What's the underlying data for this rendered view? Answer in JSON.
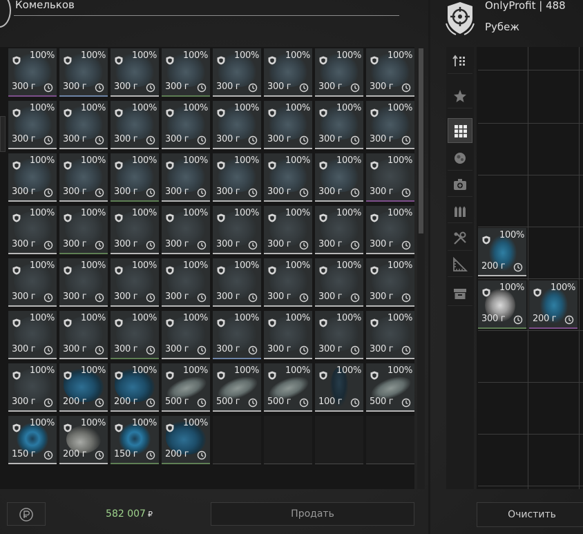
{
  "left_panel": {
    "title": "Комельков",
    "items": [
      {
        "row": 0,
        "col": 0,
        "icon": "needle-cluster-icon",
        "rarity": "violet",
        "durability": "100%",
        "price": "300 г"
      },
      {
        "row": 0,
        "col": 1,
        "icon": "needle-cluster-icon",
        "rarity": "blue",
        "durability": "100%",
        "price": "300 г"
      },
      {
        "row": 0,
        "col": 2,
        "icon": "needle-cluster-icon",
        "rarity": "white",
        "durability": "100%",
        "price": "300 г"
      },
      {
        "row": 0,
        "col": 3,
        "icon": "needle-cluster-icon",
        "rarity": "green",
        "durability": "100%",
        "price": "300 г"
      },
      {
        "row": 0,
        "col": 4,
        "icon": "needle-cluster-icon",
        "rarity": "white",
        "durability": "100%",
        "price": "300 г"
      },
      {
        "row": 0,
        "col": 5,
        "icon": "needle-cluster-icon",
        "rarity": "white",
        "durability": "100%",
        "price": "300 г"
      },
      {
        "row": 0,
        "col": 6,
        "icon": "needle-cluster-icon",
        "rarity": "white",
        "durability": "100%",
        "price": "300 г"
      },
      {
        "row": 0,
        "col": 7,
        "icon": "needle-cluster-icon",
        "rarity": "white",
        "durability": "100%",
        "price": "300 г"
      },
      {
        "row": 1,
        "col": 0,
        "icon": "needle-cluster-icon",
        "rarity": "white",
        "durability": "100%",
        "price": "300 г"
      },
      {
        "row": 1,
        "col": 1,
        "icon": "needle-cluster-icon",
        "rarity": "white",
        "durability": "100%",
        "price": "300 г"
      },
      {
        "row": 1,
        "col": 2,
        "icon": "needle-cluster-icon",
        "rarity": "white",
        "durability": "100%",
        "price": "300 г"
      },
      {
        "row": 1,
        "col": 3,
        "icon": "needle-cluster-icon",
        "rarity": "white",
        "durability": "100%",
        "price": "300 г"
      },
      {
        "row": 1,
        "col": 4,
        "icon": "needle-cluster-icon",
        "rarity": "white",
        "durability": "100%",
        "price": "300 г"
      },
      {
        "row": 1,
        "col": 5,
        "icon": "needle-cluster-icon",
        "rarity": "white",
        "durability": "100%",
        "price": "300 г"
      },
      {
        "row": 1,
        "col": 6,
        "icon": "needle-cluster-icon",
        "rarity": "white",
        "durability": "100%",
        "price": "300 г"
      },
      {
        "row": 1,
        "col": 7,
        "icon": "needle-cluster-icon",
        "rarity": "white",
        "durability": "100%",
        "price": "300 г"
      },
      {
        "row": 2,
        "col": 0,
        "icon": "needle-cluster-icon",
        "rarity": "white",
        "durability": "100%",
        "price": "300 г"
      },
      {
        "row": 2,
        "col": 1,
        "icon": "needle-cluster-icon",
        "rarity": "white",
        "durability": "100%",
        "price": "300 г"
      },
      {
        "row": 2,
        "col": 2,
        "icon": "needle-cluster-icon",
        "rarity": "green",
        "durability": "100%",
        "price": "300 г"
      },
      {
        "row": 2,
        "col": 3,
        "icon": "needle-cluster-icon",
        "rarity": "white",
        "durability": "100%",
        "price": "300 г"
      },
      {
        "row": 2,
        "col": 4,
        "icon": "needle-cluster-icon",
        "rarity": "white",
        "durability": "100%",
        "price": "300 г"
      },
      {
        "row": 2,
        "col": 5,
        "icon": "needle-cluster-icon",
        "rarity": "white",
        "durability": "100%",
        "price": "300 г"
      },
      {
        "row": 2,
        "col": 6,
        "icon": "needle-cluster-icon",
        "rarity": "white",
        "durability": "100%",
        "price": "300 г"
      },
      {
        "row": 2,
        "col": 7,
        "icon": "rock-cluster-icon",
        "rarity": "violet",
        "durability": "100%",
        "price": "300 г"
      },
      {
        "row": 3,
        "col": 0,
        "icon": "rock-cluster-icon",
        "rarity": "white",
        "durability": "100%",
        "price": "300 г"
      },
      {
        "row": 3,
        "col": 1,
        "icon": "rock-cluster-icon",
        "rarity": "green",
        "durability": "100%",
        "price": "300 г"
      },
      {
        "row": 3,
        "col": 2,
        "icon": "rock-cluster-icon",
        "rarity": "white",
        "durability": "100%",
        "price": "300 г"
      },
      {
        "row": 3,
        "col": 3,
        "icon": "rock-cluster-icon",
        "rarity": "white",
        "durability": "100%",
        "price": "300 г"
      },
      {
        "row": 3,
        "col": 4,
        "icon": "rock-cluster-icon",
        "rarity": "white",
        "durability": "100%",
        "price": "300 г"
      },
      {
        "row": 3,
        "col": 5,
        "icon": "rock-cluster-icon",
        "rarity": "white",
        "durability": "100%",
        "price": "300 г"
      },
      {
        "row": 3,
        "col": 6,
        "icon": "rock-cluster-icon",
        "rarity": "white",
        "durability": "100%",
        "price": "300 г"
      },
      {
        "row": 3,
        "col": 7,
        "icon": "rock-cluster-icon",
        "rarity": "white",
        "durability": "100%",
        "price": "300 г"
      },
      {
        "row": 4,
        "col": 0,
        "icon": "rock-cluster-icon",
        "rarity": "white",
        "durability": "100%",
        "price": "300 г"
      },
      {
        "row": 4,
        "col": 1,
        "icon": "rock-cluster-icon",
        "rarity": "white",
        "durability": "100%",
        "price": "300 г"
      },
      {
        "row": 4,
        "col": 2,
        "icon": "rock-cluster-icon",
        "rarity": "white",
        "durability": "100%",
        "price": "300 г"
      },
      {
        "row": 4,
        "col": 3,
        "icon": "rock-cluster-icon",
        "rarity": "white",
        "durability": "100%",
        "price": "300 г"
      },
      {
        "row": 4,
        "col": 4,
        "icon": "rock-cluster-icon",
        "rarity": "white",
        "durability": "100%",
        "price": "300 г"
      },
      {
        "row": 4,
        "col": 5,
        "icon": "rock-cluster-icon",
        "rarity": "white",
        "durability": "100%",
        "price": "300 г"
      },
      {
        "row": 4,
        "col": 6,
        "icon": "rock-cluster-icon",
        "rarity": "white",
        "durability": "100%",
        "price": "300 г"
      },
      {
        "row": 4,
        "col": 7,
        "icon": "rock-cluster-icon",
        "rarity": "white",
        "durability": "100%",
        "price": "300 г"
      },
      {
        "row": 5,
        "col": 0,
        "icon": "rock-cluster-icon",
        "rarity": "white",
        "durability": "100%",
        "price": "300 г"
      },
      {
        "row": 5,
        "col": 1,
        "icon": "rock-cluster-icon",
        "rarity": "white",
        "durability": "100%",
        "price": "300 г"
      },
      {
        "row": 5,
        "col": 2,
        "icon": "rock-cluster-icon",
        "rarity": "green",
        "durability": "100%",
        "price": "300 г"
      },
      {
        "row": 5,
        "col": 3,
        "icon": "rock-cluster-icon",
        "rarity": "white",
        "durability": "100%",
        "price": "300 г"
      },
      {
        "row": 5,
        "col": 4,
        "icon": "rock-cluster-icon",
        "rarity": "blue",
        "durability": "100%",
        "price": "300 г"
      },
      {
        "row": 5,
        "col": 5,
        "icon": "rock-cluster-icon",
        "rarity": "white",
        "durability": "100%",
        "price": "300 г"
      },
      {
        "row": 5,
        "col": 6,
        "icon": "rock-cluster-icon",
        "rarity": "white",
        "durability": "100%",
        "price": "300 г"
      },
      {
        "row": 5,
        "col": 7,
        "icon": "rock-cluster-icon",
        "rarity": "white",
        "durability": "100%",
        "price": "300 г"
      },
      {
        "row": 6,
        "col": 0,
        "icon": "rock-cluster-icon",
        "rarity": "white",
        "durability": "100%",
        "price": "300 г"
      },
      {
        "row": 6,
        "col": 1,
        "icon": "blue-crystal-icon",
        "rarity": "white",
        "durability": "100%",
        "price": "200 г"
      },
      {
        "row": 6,
        "col": 2,
        "icon": "blue-crystal-icon",
        "rarity": "white",
        "durability": "100%",
        "price": "200 г"
      },
      {
        "row": 6,
        "col": 3,
        "icon": "grey-branch-icon",
        "rarity": "white",
        "durability": "100%",
        "price": "500 г"
      },
      {
        "row": 6,
        "col": 4,
        "icon": "grey-branch-icon",
        "rarity": "white",
        "durability": "100%",
        "price": "500 г"
      },
      {
        "row": 6,
        "col": 5,
        "icon": "grey-branch-icon",
        "rarity": "white",
        "durability": "100%",
        "price": "500 г"
      },
      {
        "row": 6,
        "col": 6,
        "icon": "dark-shard-icon",
        "rarity": "white",
        "durability": "100%",
        "price": "100 г"
      },
      {
        "row": 6,
        "col": 7,
        "icon": "grey-branch-icon",
        "rarity": "white",
        "durability": "100%",
        "price": "500 г"
      },
      {
        "row": 7,
        "col": 0,
        "icon": "blue-ring-icon",
        "rarity": "white",
        "durability": "100%",
        "price": "150 г"
      },
      {
        "row": 7,
        "col": 1,
        "icon": "pale-horn-icon",
        "rarity": "white",
        "durability": "100%",
        "price": "200 г"
      },
      {
        "row": 7,
        "col": 2,
        "icon": "blue-ring-icon",
        "rarity": "green",
        "durability": "100%",
        "price": "150 г"
      },
      {
        "row": 7,
        "col": 3,
        "icon": "blue-crystal-icon",
        "rarity": "green",
        "durability": "100%",
        "price": "200 г"
      }
    ],
    "rows": 9,
    "cols": 8,
    "total_value": "582 007",
    "currency": "₽",
    "sell_label": "Продать"
  },
  "right_panel": {
    "trader_name": "OnlyProfit | 488",
    "trader_subtitle": "Рубеж",
    "tabs": [
      {
        "icon": "sort-icon",
        "active": false
      },
      {
        "icon": "star-icon",
        "active": false
      },
      {
        "icon": "grid-icon",
        "active": true
      },
      {
        "icon": "artifact-icon",
        "active": false
      },
      {
        "icon": "medkit-icon",
        "active": false
      },
      {
        "icon": "ammo-icon",
        "active": false
      },
      {
        "icon": "tools-icon",
        "active": false
      },
      {
        "icon": "ruler-icon",
        "active": false
      },
      {
        "icon": "box-icon",
        "active": false
      }
    ],
    "items": [
      {
        "row": 3,
        "col": 0,
        "icon": "blue-spike-icon",
        "rarity": "white",
        "durability": "100%",
        "price": "200 г"
      },
      {
        "row": 4,
        "col": 0,
        "icon": "glow-orb-icon",
        "rarity": "green",
        "durability": "100%",
        "price": "300 г"
      },
      {
        "row": 4,
        "col": 1,
        "icon": "blue-spike-icon",
        "rarity": "violet",
        "durability": "100%",
        "price": "200 г"
      }
    ],
    "clear_label": "Очистить"
  },
  "colors": {
    "rarity_white": "#b8b8b8",
    "rarity_green": "#5f7f55",
    "rarity_blue": "#6f85a8",
    "rarity_violet": "#7e4f8c",
    "total_value": "#9fd48d"
  }
}
